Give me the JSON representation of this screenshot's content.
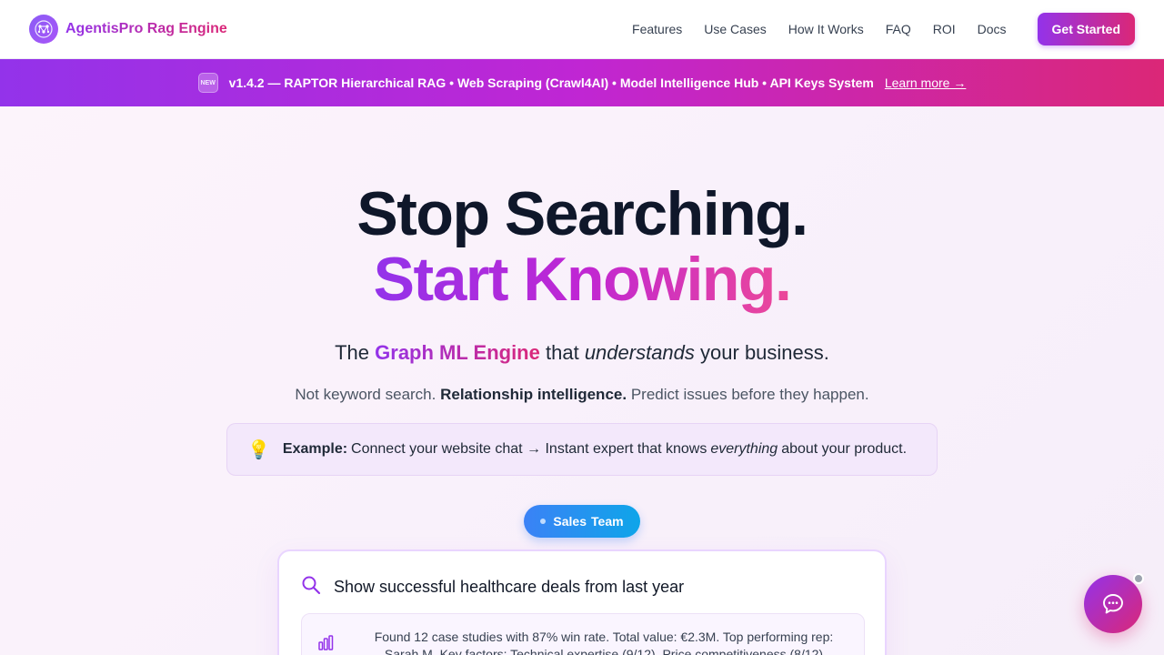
{
  "brand": {
    "name": "AgentisPro Rag Engine",
    "logo_icon": "neural-network-icon"
  },
  "nav": {
    "links": [
      "Features",
      "Use Cases",
      "How It Works",
      "FAQ",
      "ROI",
      "Docs"
    ],
    "cta_label": "Get Started"
  },
  "announcement": {
    "badge": "NEW",
    "text": "v1.4.2 — RAPTOR Hierarchical RAG • Web Scraping (Crawl4AI) • Model Intelligence Hub • API Keys System",
    "link_label": "Learn more →"
  },
  "hero": {
    "line1": "Stop Searching.",
    "line2": "Start Knowing.",
    "tagline_pre": "The",
    "tagline_highlight": "Graph ML Engine",
    "tagline_mid": "that",
    "tagline_em": "understands",
    "tagline_post": "your business.",
    "sub_pre": "Not keyword search.",
    "sub_strong": "Relationship intelligence.",
    "sub_post": "Predict issues before they happen."
  },
  "example": {
    "icon": "lightbulb-icon",
    "label": "Example:",
    "text_pre": "Connect your website chat → Instant expert that knows",
    "text_em": "everything",
    "text_post": "about your product."
  },
  "team_pill": {
    "word1": "Sales",
    "word2": "Team"
  },
  "demo": {
    "query": "Show successful healthcare deals from last year",
    "result": "Found 12 case studies with 87% win rate. Total value: €2.3M. Top performing rep: Sarah M. Key factors: Technical expertise (9/12), Price competitiveness (8/12)"
  },
  "colors": {
    "brand_purple": "#9333ea",
    "brand_pink": "#db2777",
    "team_blue": "#3b82f6"
  }
}
